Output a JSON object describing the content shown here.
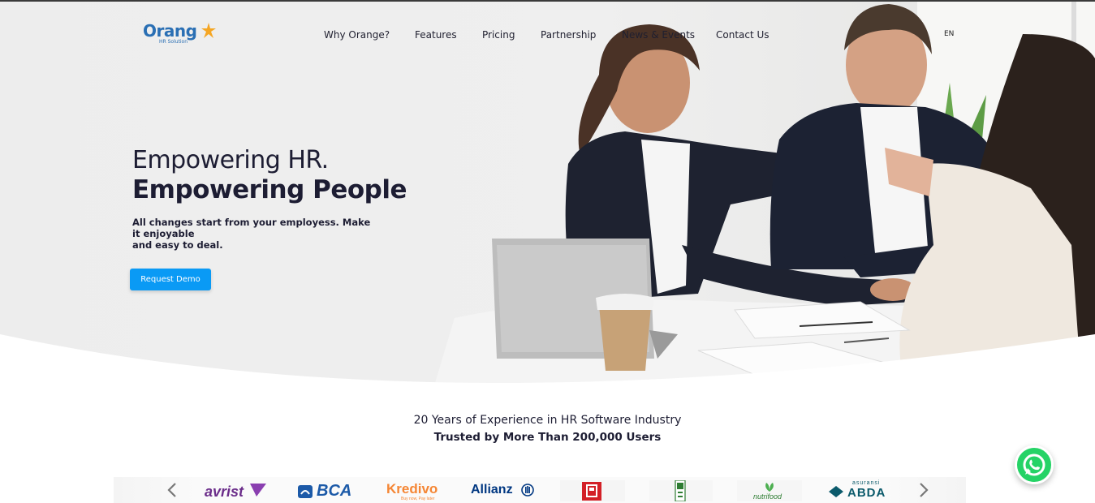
{
  "brand": {
    "logo_word": "Orang",
    "logo_sub": "HR Solution",
    "primary_color": "#0a9af5",
    "logo_color": "#2a6fb4",
    "accent_color": "#f5a623"
  },
  "nav": {
    "items": [
      "Why Orange?",
      "Features",
      "Pricing",
      "Partnership",
      "News & Events",
      "Contact Us"
    ],
    "lang": "EN"
  },
  "hero": {
    "headline_1": "Empowering HR.",
    "headline_2": "Empowering People",
    "subtitle_1": "All changes start from your employess. Make it enjoyable",
    "subtitle_2": "and easy to deal.",
    "cta": "Request Demo",
    "image": "business-handshake-photo"
  },
  "trust": {
    "experience": "20 Years of Experience in HR Software Industry",
    "users": "Trusted by More Than 200,000 Users"
  },
  "clients": {
    "logos": [
      {
        "name": "avrist",
        "icon": "avrist-logo"
      },
      {
        "name": "BCA",
        "icon": "bca-logo"
      },
      {
        "name": "Kredivo",
        "icon": "kredivo-logo"
      },
      {
        "name": "Allianz",
        "icon": "allianz-logo"
      },
      {
        "name": "",
        "icon": "red-square-logo"
      },
      {
        "name": "",
        "icon": "green-vertical-logo"
      },
      {
        "name": "nutrifood",
        "icon": "nutrifood-logo"
      },
      {
        "name": "ABDA",
        "icon": "abda-logo"
      }
    ],
    "kredivo_tagline": "Buy now, Pay later",
    "abda_top": "asuransi",
    "prev_icon": "chevron-left-icon",
    "next_icon": "chevron-right-icon"
  },
  "whatsapp": {
    "icon": "whatsapp-icon",
    "color": "#25d366"
  }
}
